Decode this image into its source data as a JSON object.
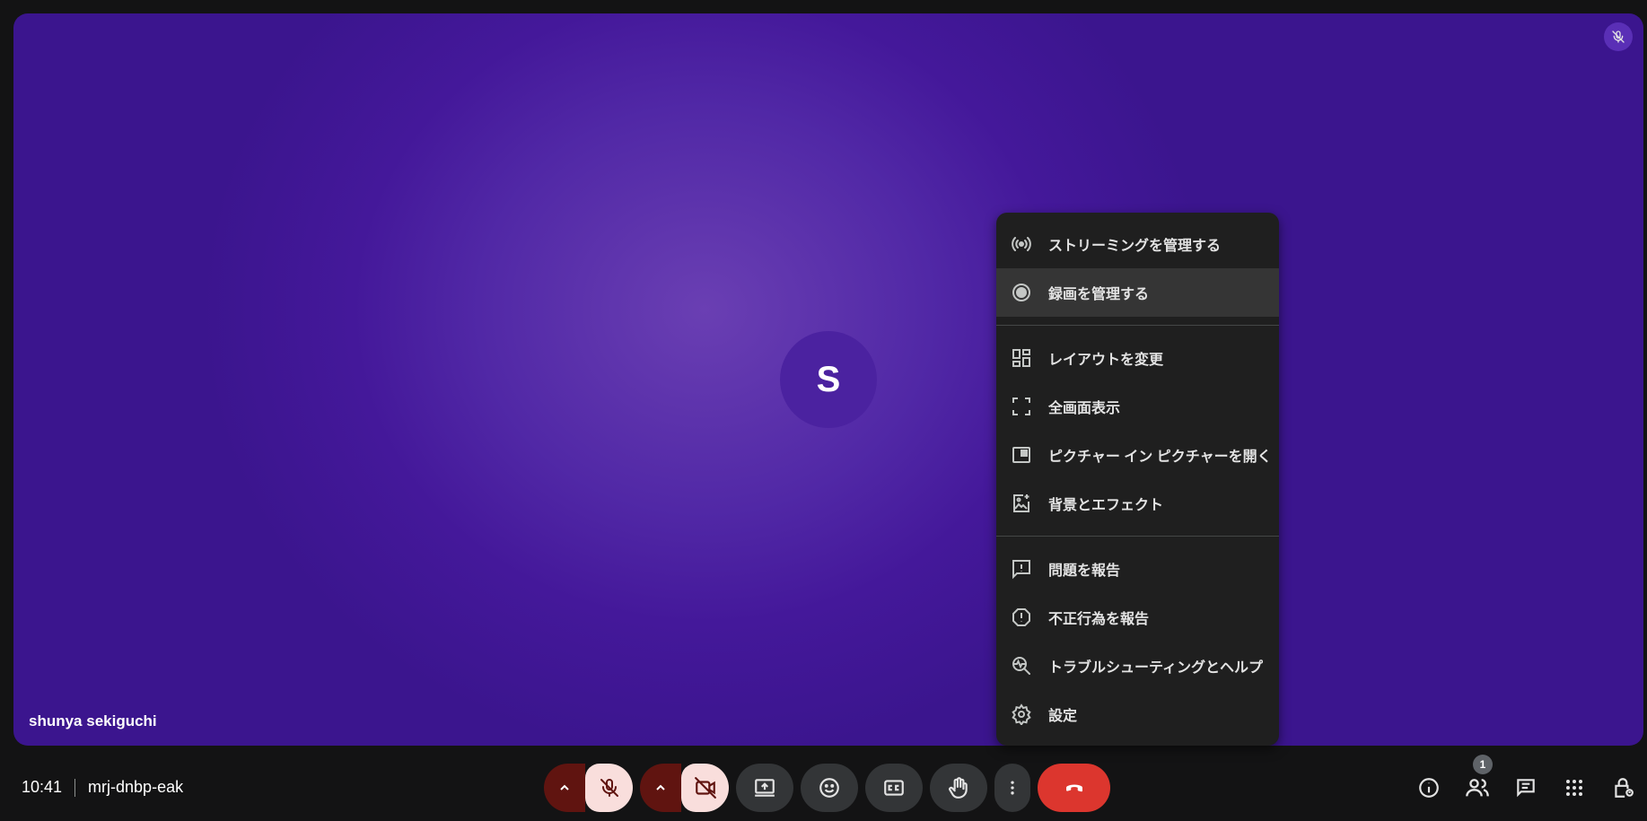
{
  "participant": {
    "initial": "S",
    "name": "shunya sekiguchi"
  },
  "menu": {
    "groups": [
      [
        {
          "label": "ストリーミングを管理する",
          "icon": "broadcast-icon"
        },
        {
          "label": "録画を管理する",
          "icon": "record-icon",
          "active": true
        }
      ],
      [
        {
          "label": "レイアウトを変更",
          "icon": "layout-icon"
        },
        {
          "label": "全画面表示",
          "icon": "fullscreen-icon"
        },
        {
          "label": "ピクチャー イン ピクチャーを開く",
          "icon": "picture-in-picture-icon"
        },
        {
          "label": "背景とエフェクト",
          "icon": "background-effects-icon"
        }
      ],
      [
        {
          "label": "問題を報告",
          "icon": "report-problem-icon"
        },
        {
          "label": "不正行為を報告",
          "icon": "report-abuse-icon"
        },
        {
          "label": "トラブルシューティングとヘルプ",
          "icon": "troubleshoot-icon"
        },
        {
          "label": "設定",
          "icon": "settings-icon"
        }
      ]
    ]
  },
  "bottom_bar": {
    "time": "10:41",
    "meeting_code": "mrj-dnbp-eak",
    "participant_count": "1"
  },
  "colors": {
    "stage": "#5128a6",
    "hangup": "#dc362e",
    "muted_bg": "#f9dedc",
    "muted_arrow_bg": "#601410",
    "menu_bg": "#1f1f1f"
  }
}
